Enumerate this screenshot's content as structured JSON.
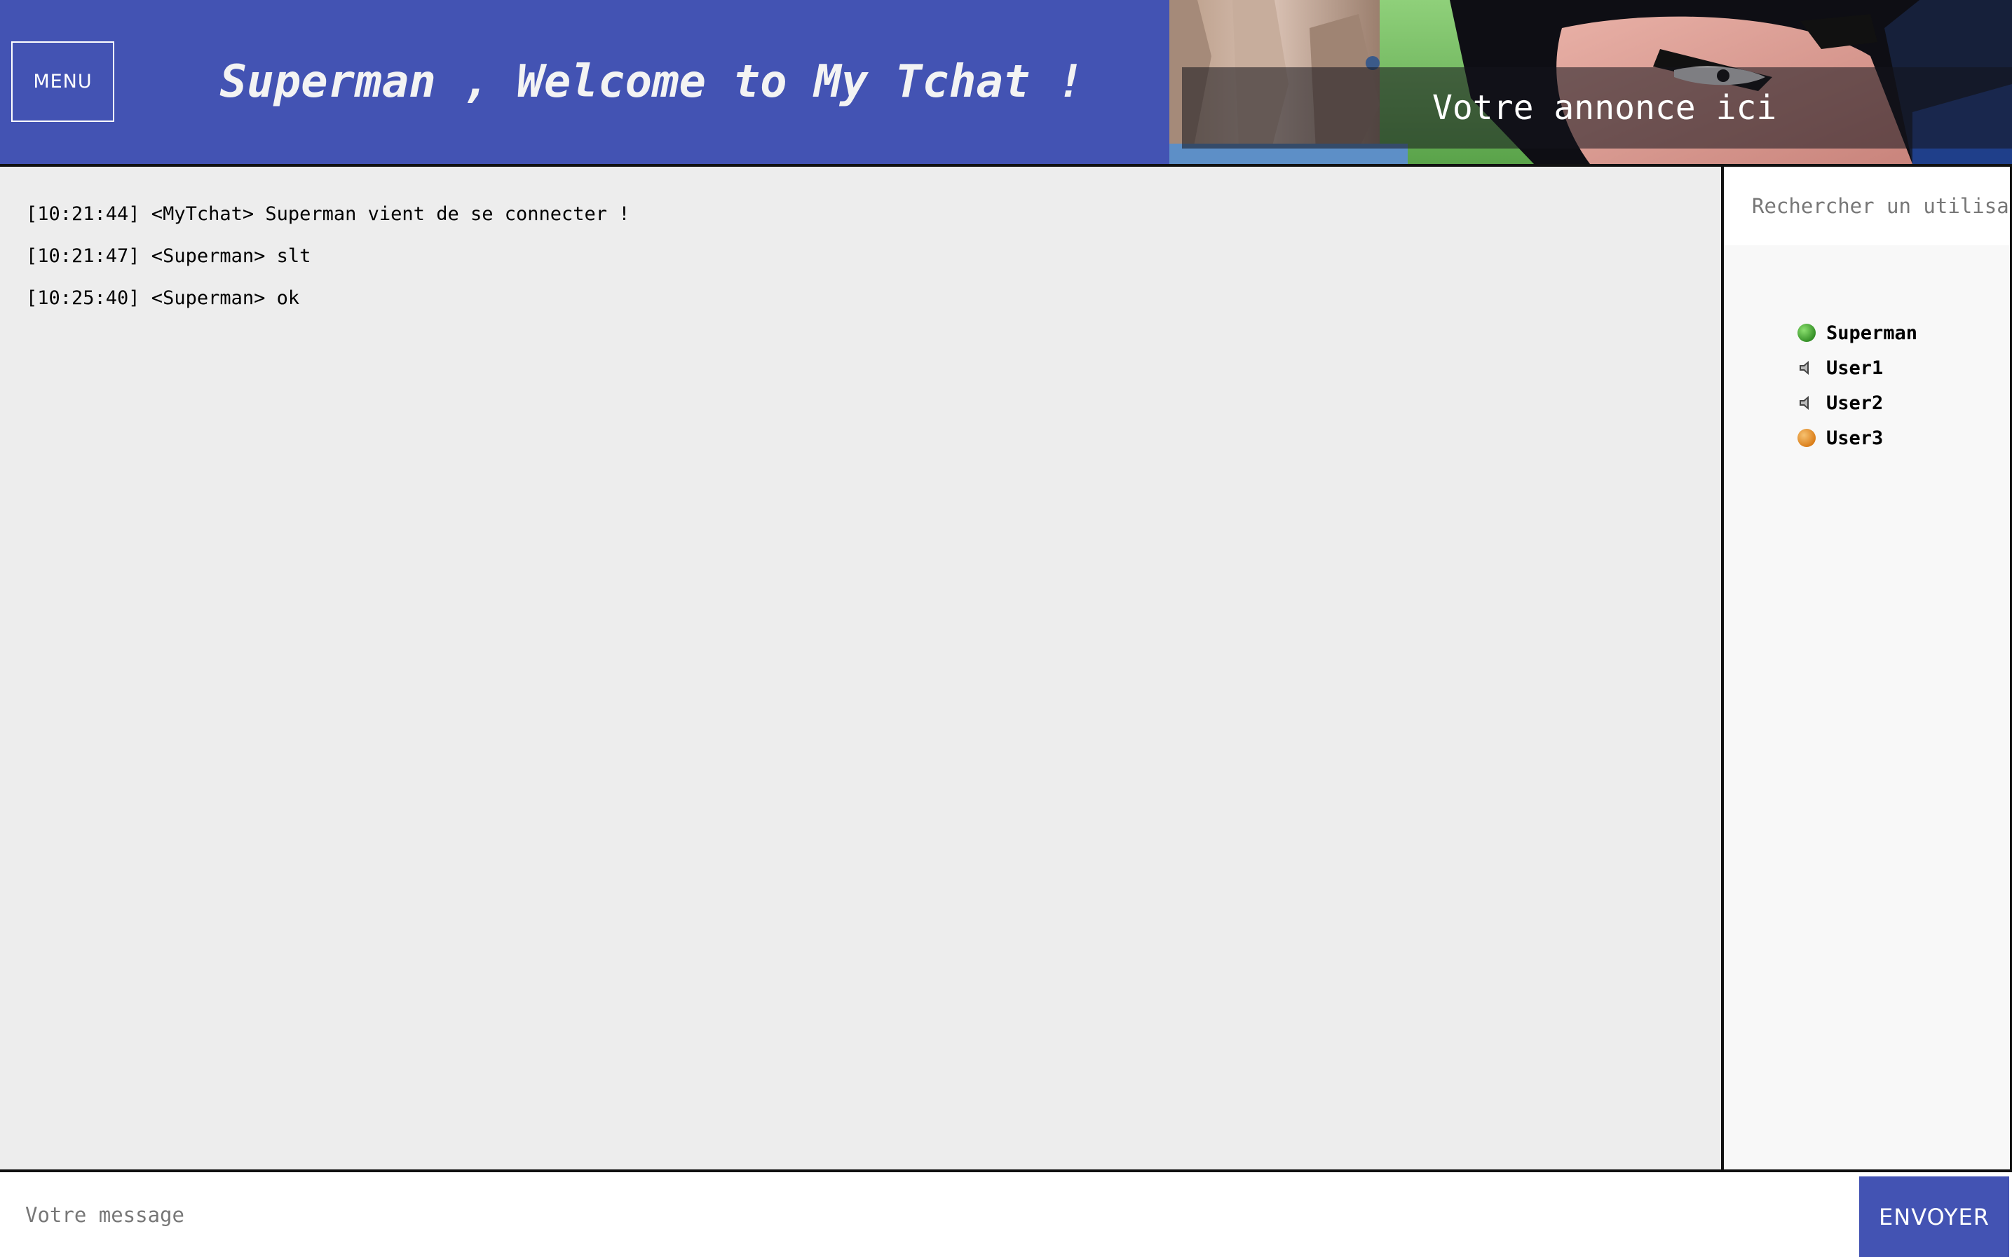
{
  "header": {
    "menu_label": "MENU",
    "title": "Superman , Welcome to My Tchat !",
    "banner_text": "Votre annonce ici"
  },
  "chat": {
    "messages": [
      "[10:21:44] <MyTchat> Superman vient de se connecter !",
      "[10:21:47] <Superman> slt",
      "[10:25:40] <Superman> ok"
    ]
  },
  "sidebar": {
    "search_placeholder": "Rechercher un utilisateur",
    "users": [
      {
        "name": "Superman",
        "status_icon": "green-dot-icon",
        "color": "#3fa62f"
      },
      {
        "name": "User1",
        "status_icon": "speaker-icon",
        "color": "#333333"
      },
      {
        "name": "User2",
        "status_icon": "speaker-icon",
        "color": "#333333"
      },
      {
        "name": "User3",
        "status_icon": "orange-dot-icon",
        "color": "#e08a22"
      }
    ]
  },
  "footer": {
    "message_placeholder": "Votre message",
    "send_label": "ENVOYER"
  },
  "colors": {
    "accent": "#4353b3",
    "chat_bg": "#ededed"
  }
}
